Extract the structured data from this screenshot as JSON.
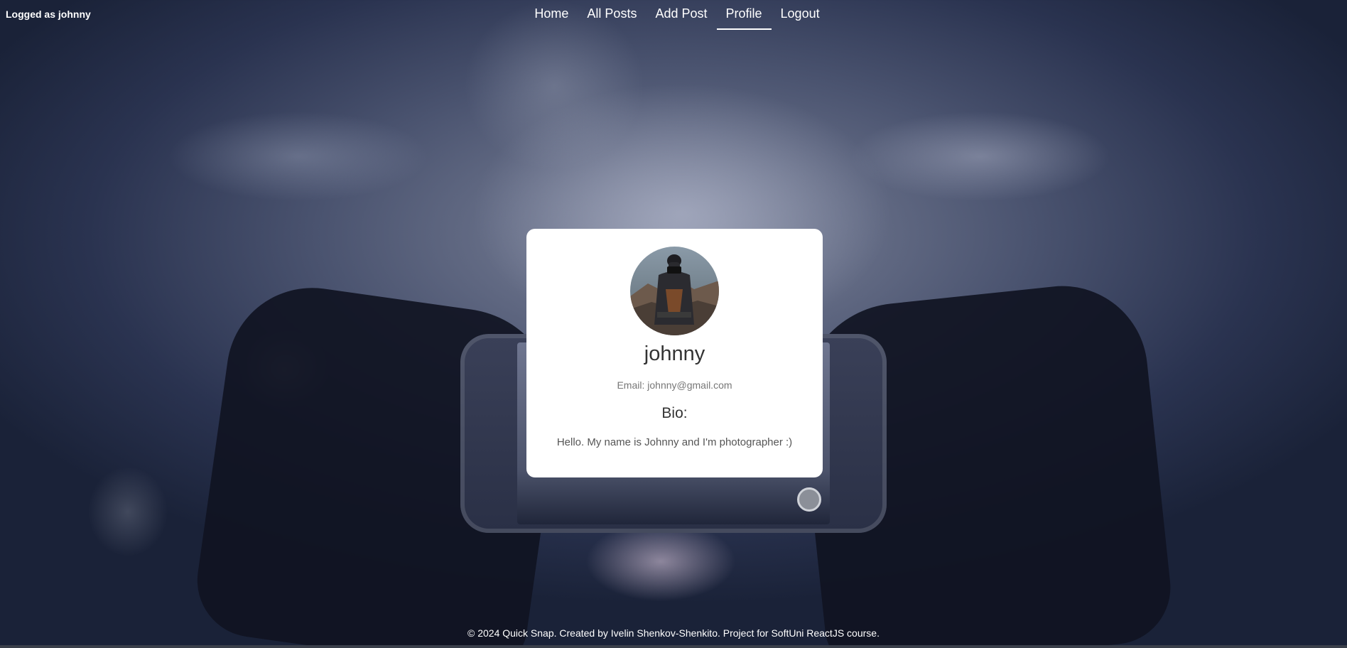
{
  "status": {
    "logged_as": "Logged as johnny"
  },
  "nav": {
    "items": [
      {
        "label": "Home",
        "active": false
      },
      {
        "label": "All Posts",
        "active": false
      },
      {
        "label": "Add Post",
        "active": false
      },
      {
        "label": "Profile",
        "active": true
      },
      {
        "label": "Logout",
        "active": false
      }
    ]
  },
  "profile": {
    "avatar_icon": "user-avatar-photo",
    "username": "johnny",
    "email": "Email: johnny@gmail.com",
    "bio_title": "Bio:",
    "bio_text": "Hello. My name is Johnny and I'm photographer :)"
  },
  "footer": {
    "text": "© 2024 Quick Snap. Created by Ivelin Shenkov-Shenkito. Project for SoftUni ReactJS course."
  },
  "colors": {
    "card_bg": "#ffffff",
    "nav_text": "#ffffff",
    "background_dark": "#1a2238"
  }
}
